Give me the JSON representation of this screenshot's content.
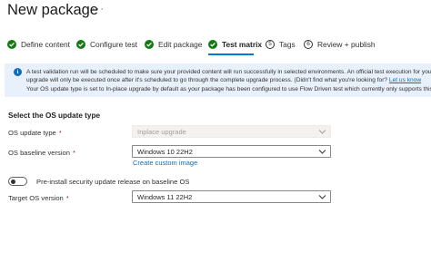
{
  "page": {
    "title": "New package",
    "more_label": "···"
  },
  "steps": [
    {
      "label": "Define content",
      "state": "complete"
    },
    {
      "label": "Configure test",
      "state": "complete"
    },
    {
      "label": "Edit package",
      "state": "complete"
    },
    {
      "label": "Test matrix",
      "state": "current"
    },
    {
      "label": "Tags",
      "state": "pending",
      "number": "5"
    },
    {
      "label": "Review + publish",
      "state": "pending",
      "number": "6"
    }
  ],
  "info": {
    "line1": "A test validation run will be scheduled to make sure your provided content will run successfully in selected environments. An official test execution for your package will also be scheduled.",
    "line2_text": "upgrade will only be executed once after it's scheduled to go through the complete upgrade process. (Didn't find what you're looking for? ",
    "line2_link": "Let us know",
    "line3": "Your OS update type is set to In-place upgrade by default as your package has been configured to use Flow Driven test which currently only supports this type."
  },
  "form": {
    "section_title": "Select the OS update type",
    "update_type": {
      "label": "OS update type",
      "required_mark": "*",
      "value": "Inplace upgrade"
    },
    "baseline": {
      "label": "OS baseline version",
      "required_mark": "*",
      "value": "Windows 10 22H2"
    },
    "create_image_link": "Create custom image",
    "toggle_label": "Pre-install security update release on baseline OS",
    "target": {
      "label": "Target OS version",
      "required_mark": "*",
      "value": "Windows 11 22H2"
    }
  },
  "colors": {
    "complete": "#107c10",
    "accent": "#0078d4",
    "info_bg": "#e8f1fb"
  }
}
